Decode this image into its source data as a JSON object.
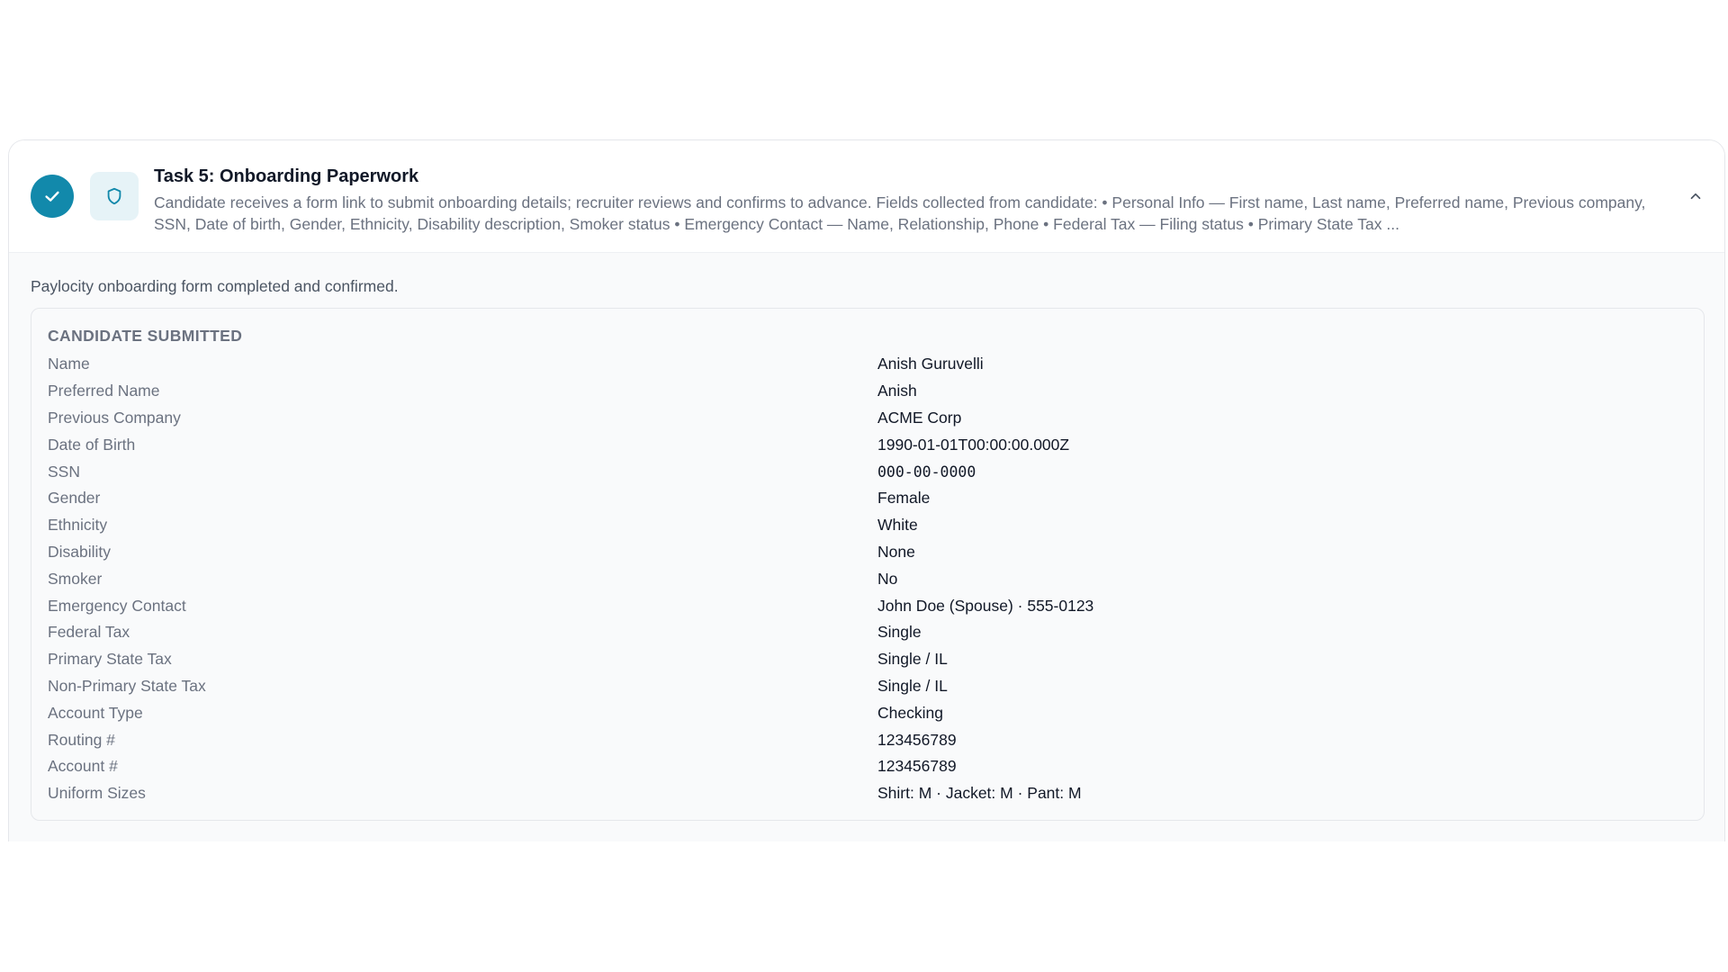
{
  "task": {
    "title": "Task 5: Onboarding Paperwork",
    "description": "Candidate receives a form link to submit onboarding details; recruiter reviews and confirms to advance. Fields collected from candidate: • Personal Info — First name, Last name, Preferred name, Previous company, SSN, Date of birth, Gender, Ethnicity, Disability description, Smoker status • Emergency Contact — Name, Relationship, Phone • Federal Tax — Filing status • Primary State Tax ...",
    "status_icon": "check-icon",
    "type_icon": "shield-icon",
    "toggle_icon": "chevron-up-icon",
    "accent_color": "#1289ab"
  },
  "summary": "Paylocity onboarding form completed and confirmed.",
  "candidate_submitted": {
    "heading": "CANDIDATE SUBMITTED",
    "fields": [
      {
        "label": "Name",
        "value": "Anish Guruvelli"
      },
      {
        "label": "Preferred Name",
        "value": "Anish"
      },
      {
        "label": "Previous Company",
        "value": "ACME Corp"
      },
      {
        "label": "Date of Birth",
        "value": "1990-01-01T00:00:00.000Z"
      },
      {
        "label": "SSN",
        "value": "000-00-0000"
      },
      {
        "label": "Gender",
        "value": "Female"
      },
      {
        "label": "Ethnicity",
        "value": "White"
      },
      {
        "label": "Disability",
        "value": "None"
      },
      {
        "label": "Smoker",
        "value": "No"
      },
      {
        "label": "Emergency Contact",
        "value": "John Doe (Spouse) · 555-0123"
      },
      {
        "label": "Federal Tax",
        "value": "Single"
      },
      {
        "label": "Primary State Tax",
        "value": "Single / IL"
      },
      {
        "label": "Non-Primary State Tax",
        "value": "Single / IL"
      },
      {
        "label": "Account Type",
        "value": "Checking"
      },
      {
        "label": "Routing #",
        "value": "123456789"
      },
      {
        "label": "Account #",
        "value": "123456789"
      },
      {
        "label": "Uniform Sizes",
        "value": "Shirt: M · Jacket: M · Pant: M"
      }
    ]
  }
}
